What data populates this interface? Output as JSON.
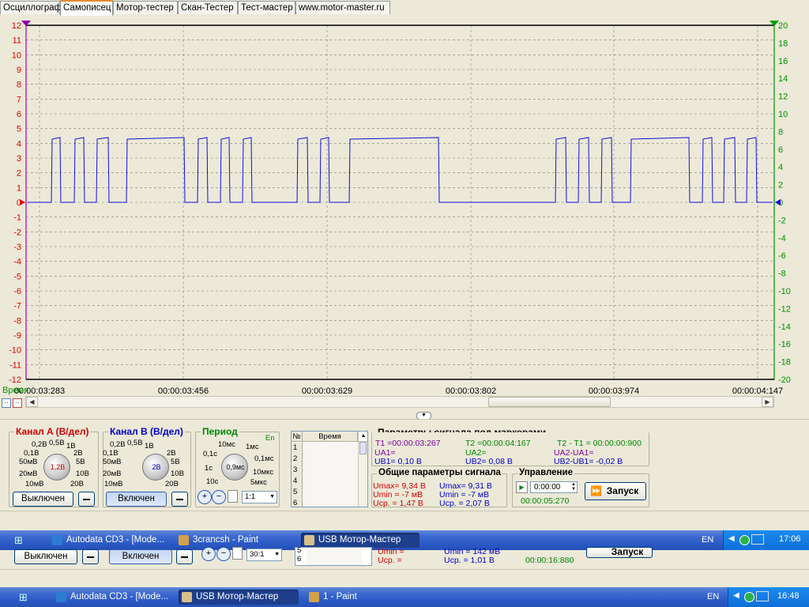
{
  "tabs": [
    "Осциллограф",
    "Самописец",
    "Мотор-тестер",
    "Скан-Тестер",
    "Тест-мастер",
    "www.motor-master.ru"
  ],
  "active_tab": 1,
  "scope": {
    "left_axis": [
      "12",
      "11",
      "10",
      "9",
      "8",
      "7",
      "6",
      "5",
      "4",
      "3",
      "2",
      "1",
      "0",
      "-1",
      "-2",
      "-3",
      "-4",
      "-5",
      "-6",
      "-7",
      "-8",
      "-9",
      "-10",
      "-11",
      "-12"
    ],
    "right_axis": [
      "20",
      "18",
      "16",
      "14",
      "12",
      "10",
      "8",
      "6",
      "4",
      "2",
      "0",
      "-2",
      "-4",
      "-6",
      "-8",
      "-10",
      "-12",
      "-14",
      "-16",
      "-18",
      "-20"
    ],
    "time_label": "Время",
    "time_ticks": [
      "00:00:03:283",
      "00:00:03:456",
      "00:00:03:629",
      "00:00:03:802",
      "00:00:03:974",
      "00:00:04:147"
    ],
    "colors": {
      "trace": "#1010e0",
      "grid": "#808080",
      "left_axis": "#e00000",
      "right_axis": "#009000",
      "background": "#ece9d8"
    }
  },
  "channel_a": {
    "title": "Канал A (В/дел)",
    "scale": [
      "0,2В",
      "0,5В",
      "1В",
      "0,1В",
      "2В",
      "50мВ",
      "5В",
      "20мВ",
      "10В",
      "10мВ",
      "20В"
    ],
    "value": "1,2В",
    "button": "Выключен"
  },
  "channel_b": {
    "title": "Канал B (В/дел)",
    "scale": [
      "0,2В",
      "0,5В",
      "1В",
      "0,1В",
      "2В",
      "50мВ",
      "5В",
      "20мВ",
      "10В",
      "10мВ",
      "20В"
    ],
    "value": "2В",
    "button": "Включен"
  },
  "period": {
    "title": "Период",
    "en": "En",
    "scale": [
      "10мс",
      "1мс",
      "0,1с",
      "0,1мс",
      "1с",
      "10мкс",
      "10с",
      "5мкс"
    ],
    "value": "0,9мс",
    "zoom": "1:1"
  },
  "table": {
    "col_num": "№",
    "col_time": "Время",
    "rows": [
      "1",
      "2",
      "3",
      "4",
      "5",
      "6"
    ]
  },
  "markers": {
    "title": "Параметры сигнала под маркерами",
    "t1": "T1 =00:00:03:267",
    "t2": "T2 =00:00:04:167",
    "dt": "T2 - T1 = 00:00:00:900",
    "ua1": "UA1=",
    "ub1": "UB1= 0,10 В",
    "ua2": "UA2=",
    "ub2": "UB2= 0,08 В",
    "dua": "UA2-UA1=",
    "dub": "UB2-UB1= -0,02 В"
  },
  "general": {
    "title": "Общие параметры сигнала",
    "a_max": "Umax= 9,34 В",
    "a_min": "Umin = -7 мВ",
    "a_avg": "Uср. = 1,47 В",
    "b_max": "Umax= 9,31 В",
    "b_min": "Umin = -7 мВ",
    "b_avg": "Uср. = 2,07 В"
  },
  "control": {
    "title": "Управление",
    "time": "0:00:00",
    "elapsed": "00:00:05:270",
    "start": "Запуск"
  },
  "taskbar1": {
    "items": [
      "Autodata CD3 - [Mode...",
      "3crancsh - Paint",
      "USB Мотор-Мастер"
    ],
    "lang": "EN",
    "clock": "17:06"
  },
  "ghost": {
    "btn_a": "Выключен",
    "btn_b": "Включен",
    "zoom": "30:1",
    "rows": [
      "5",
      "6"
    ],
    "umin_a": "Umin =",
    "uavg_a": "Uср. =",
    "umin_b": "Umin = 142 мВ",
    "uavg_b": "Uср. = 1,01 В",
    "elapsed": "00:00:16:880",
    "start": "Запуск"
  },
  "taskbar2": {
    "items": [
      "Autodata CD3 - [Mode...",
      "USB Мотор-Мастер",
      "1 - Paint"
    ],
    "lang": "EN",
    "clock": "16:48"
  }
}
